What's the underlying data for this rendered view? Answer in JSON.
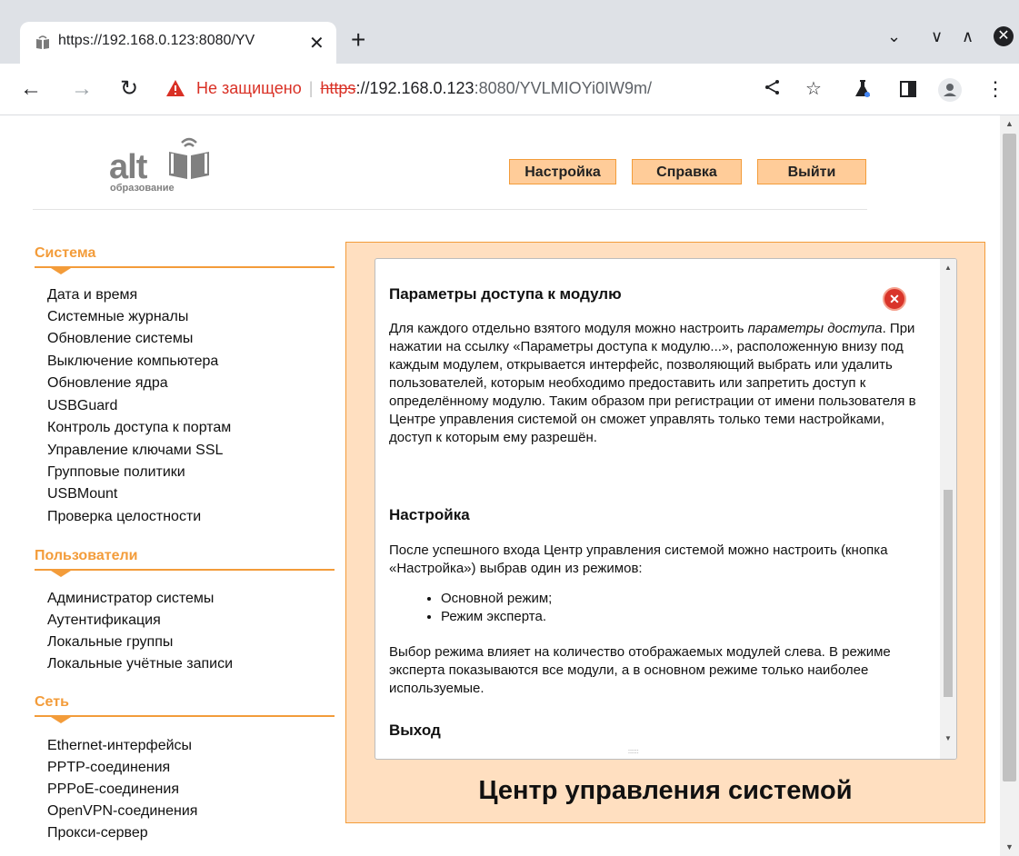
{
  "tab": {
    "title": "https://192.168.0.123:8080/YV",
    "close": "✕"
  },
  "new_tab": "+",
  "window_controls": {
    "min": "⌄",
    "chevron": "∨",
    "max": "∧",
    "close": "✕"
  },
  "toolbar": {
    "back": "←",
    "forward": "→",
    "reload": "↻",
    "not_secure": "Не защищено",
    "url_scheme": "https",
    "url_host": "://192.168.0.123",
    "url_path": ":8080/YVLMIOYi0IW9m/"
  },
  "header": {
    "logo_text": "alt",
    "logo_sub": "образование",
    "buttons": [
      "Настройка",
      "Справка",
      "Выйти"
    ]
  },
  "sidebar": {
    "sections": [
      {
        "title": "Система",
        "items": [
          "Дата и время",
          "Системные журналы",
          "Обновление системы",
          "Выключение компьютера",
          "Обновление ядра",
          "USBGuard",
          "Контроль доступа к портам",
          "Управление ключами SSL",
          "Групповые политики",
          "USBMount",
          "Проверка целостности"
        ]
      },
      {
        "title": "Пользователи",
        "items": [
          "Администратор системы",
          "Аутентификация",
          "Локальные группы",
          "Локальные учётные записи"
        ]
      },
      {
        "title": "Сеть",
        "items": [
          "Ethernet-интерфейсы",
          "PPTP-соединения",
          "PPPoE-соединения",
          "OpenVPN-соединения",
          "Прокси-сервер"
        ]
      }
    ]
  },
  "help": {
    "h1": "Параметры доступа к модулю",
    "p1_before": "Для каждого отдельно взятого модуля можно настроить ",
    "p1_em": "параметры доступа",
    "p1_after": ". При нажатии на ссылку «Параметры доступа к модулю...», расположенную внизу под каждым модулем, открывается интерфейс, позволяющий выбрать или удалить пользователей, которым необходимо предоставить или запретить доступ к определённому модулю. Таким образом при регистрации от имени пользователя в Центре управления системой он сможет управлять только теми настройками, доступ к которым ему разрешён.",
    "h2": "Настройка",
    "p2": "После успешного входа Центр управления системой можно настроить (кнопка «Настройка») выбрав один из режимов:",
    "list": [
      "Основной режим;",
      "Режим эксперта."
    ],
    "p3": "Выбор режима влияет на количество отображаемых модулей слева. В режиме эксперта показываются все модули, а в основном режиме только наиболее используемые.",
    "h3": "Выход"
  },
  "page_title": "Центр управления системой"
}
